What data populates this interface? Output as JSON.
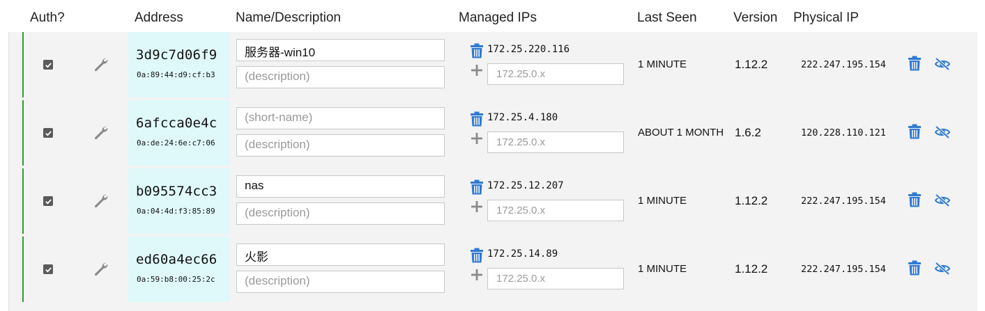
{
  "headers": {
    "auth": "Auth?",
    "address": "Address",
    "name": "Name/Description",
    "managed_ips": "Managed IPs",
    "last_seen": "Last Seen",
    "version": "Version",
    "physical_ip": "Physical IP"
  },
  "colors": {
    "accent_green": "#2e9e2e",
    "address_bg": "#dff9fb",
    "icon_blue": "#2f7ad1",
    "icon_gray": "#6f6f6f"
  },
  "icons": {
    "auth": "checkbox-checked",
    "settings": "wrench-icon",
    "remove_ip": "trash-icon",
    "add_ip": "plus-icon",
    "delete_member": "trash-icon",
    "hide_member": "eye-slash-icon"
  },
  "ip_placeholder": "172.25.0.x",
  "name_placeholder": "(short-name)",
  "desc_placeholder": "(description)",
  "members": [
    {
      "authorized": true,
      "id": "3d9c7d06f9",
      "mac": "0a:89:44:d9:cf:b3",
      "name": "服务器-win10",
      "description": "",
      "ip": "172.25.220.116",
      "last_seen": "1 MINUTE",
      "version": "1.12.2",
      "physical_ip": "222.247.195.154"
    },
    {
      "authorized": true,
      "id": "6afcca0e4c",
      "mac": "0a:de:24:6e:c7:06",
      "name": "",
      "description": "",
      "ip": "172.25.4.180",
      "last_seen": "ABOUT 1 MONTH",
      "version": "1.6.2",
      "physical_ip": "120.228.110.121"
    },
    {
      "authorized": true,
      "id": "b095574cc3",
      "mac": "0a:04:4d:f3:85:89",
      "name": "nas",
      "description": "",
      "ip": "172.25.12.207",
      "last_seen": "1 MINUTE",
      "version": "1.12.2",
      "physical_ip": "222.247.195.154"
    },
    {
      "authorized": true,
      "id": "ed60a4ec66",
      "mac": "0a:59:b8:00:25:2c",
      "name": "火影",
      "description": "",
      "ip": "172.25.14.89",
      "last_seen": "1 MINUTE",
      "version": "1.12.2",
      "physical_ip": "222.247.195.154"
    }
  ]
}
